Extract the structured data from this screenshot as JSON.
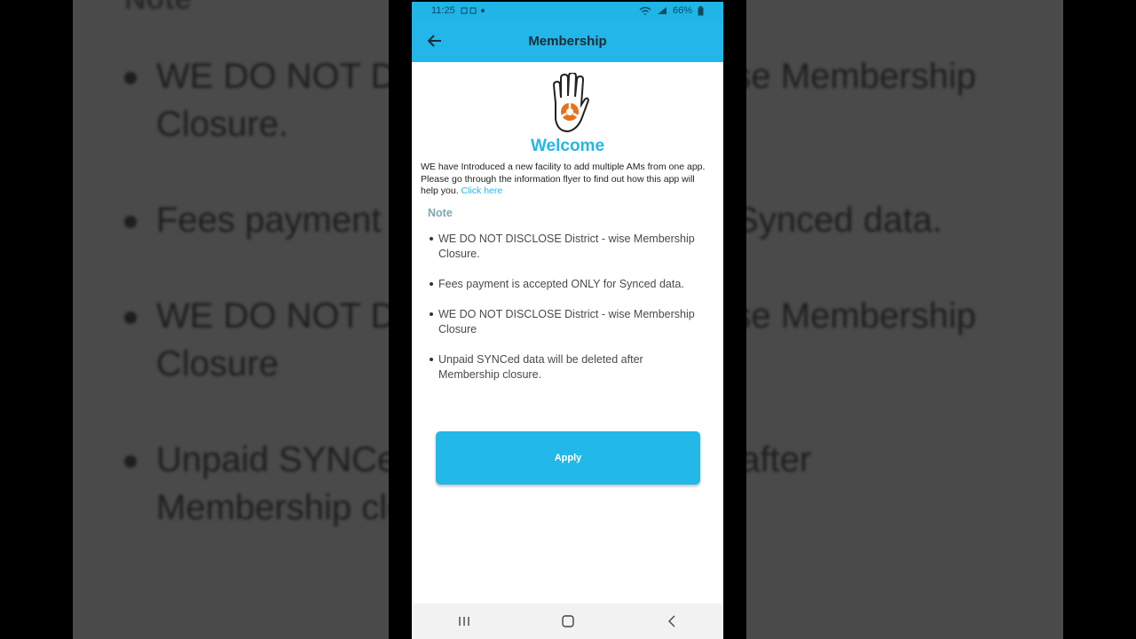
{
  "status_bar": {
    "time": "11:25",
    "battery": "66%"
  },
  "app_bar": {
    "title": "Membership"
  },
  "welcome": {
    "heading": "Welcome",
    "intro_text": "WE have Introduced a new facility to add multiple AMs from one app. Please go through the information flyer to find out how this app will help you.",
    "link_text": "Click here"
  },
  "note": {
    "heading": "Note",
    "items": [
      "WE DO NOT DISCLOSE District - wise Membership Closure.",
      "Fees payment is accepted ONLY for Synced data.",
      "WE DO NOT DISCLOSE District - wise Membership Closure",
      "Unpaid SYNCed data will be deleted after Membership closure."
    ]
  },
  "apply_button": {
    "label": "Apply"
  },
  "background": {
    "note_heading": "Note",
    "items": [
      "WE DO NOT DISCLOSE District - wise Membership Closure.",
      "Fees payment is accepted ONLY for Synced data.",
      "WE DO NOT DISCLOSE District - wise Membership Closure",
      "Unpaid SYNCed data will be deleted after Membership closure."
    ]
  },
  "colors": {
    "accent": "#23b6e8",
    "note_heading": "#7fa6b2"
  },
  "icons": [
    "back-arrow-icon",
    "wifi-icon",
    "signal-icon",
    "battery-icon",
    "recents-icon",
    "home-icon",
    "back-nav-icon"
  ]
}
